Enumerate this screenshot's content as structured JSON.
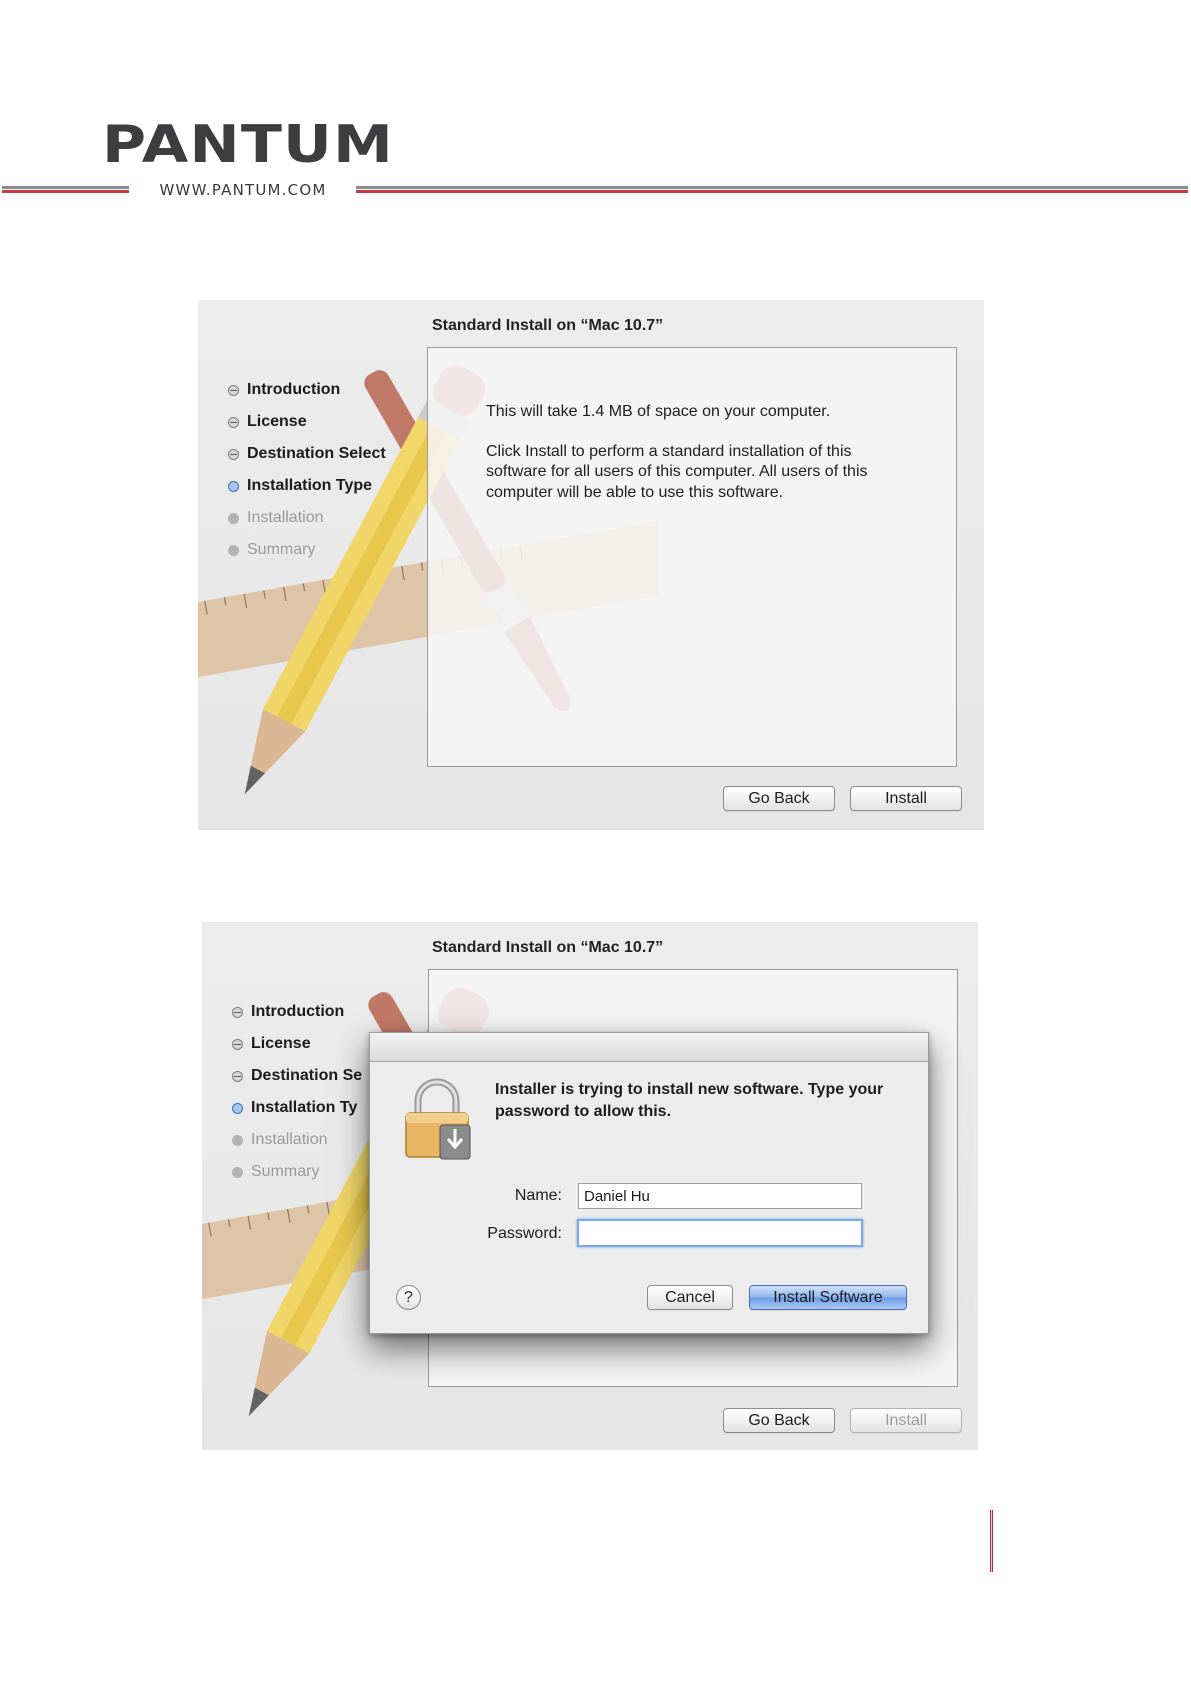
{
  "header": {
    "logo_text": "PANTUM",
    "url": "WWW.PANTUM.COM"
  },
  "screenshot1": {
    "title": "Standard Install on “Mac 10.7”",
    "steps": [
      {
        "label": "Introduction",
        "state": "done"
      },
      {
        "label": "License",
        "state": "done"
      },
      {
        "label": "Destination Select",
        "state": "done"
      },
      {
        "label": "Installation Type",
        "state": "current"
      },
      {
        "label": "Installation",
        "state": "todo"
      },
      {
        "label": "Summary",
        "state": "todo"
      }
    ],
    "body": [
      "This will take 1.4 MB of space on your computer.",
      "Click Install to perform a standard installation of this software for all users of this computer. All users of this computer will be able to use this software."
    ],
    "go_back_label": "Go Back",
    "install_label": "Install"
  },
  "screenshot2": {
    "title": "Standard Install on “Mac 10.7”",
    "steps": [
      {
        "label": "Introduction",
        "state": "done"
      },
      {
        "label": "License",
        "state": "done"
      },
      {
        "label": "Destination Se",
        "state": "done"
      },
      {
        "label": "Installation Ty",
        "state": "current"
      },
      {
        "label": "Installation",
        "state": "todo"
      },
      {
        "label": "Summary",
        "state": "todo"
      }
    ],
    "go_back_label": "Go Back",
    "install_label": "Install",
    "auth_dialog": {
      "message": "Installer is trying to install new software. Type your password to allow this.",
      "name_label": "Name:",
      "name_value": "Daniel Hu",
      "password_label": "Password:",
      "password_value": "",
      "help_label": "?",
      "cancel_label": "Cancel",
      "install_software_label": "Install Software"
    }
  },
  "colors": {
    "brand_red": "#c73a3e",
    "brand_gray": "#3d3d3f",
    "current_step_blue": "#3c6fc2"
  }
}
